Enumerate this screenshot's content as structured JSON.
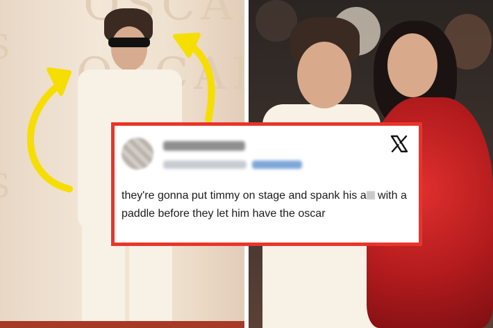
{
  "images": {
    "left_photo": {
      "description_icon": "photo-icon"
    },
    "right_photo": {
      "description_icon": "photo-icon"
    }
  },
  "backdrop_text": {
    "top": "OSCARS",
    "middle": "OSCARS",
    "edge_letters": [
      "S",
      "S"
    ]
  },
  "arrows": {
    "color": "#f5de00",
    "icons": [
      "curved-arrow-icon",
      "curved-arrow-icon"
    ]
  },
  "tweet": {
    "border_color": "#e8352b",
    "logo_icon": "x-logo-icon",
    "text_part1": "they're gonna put timmy on stage and spank his a",
    "text_part2": " with a paddle before they let him have the oscar"
  }
}
